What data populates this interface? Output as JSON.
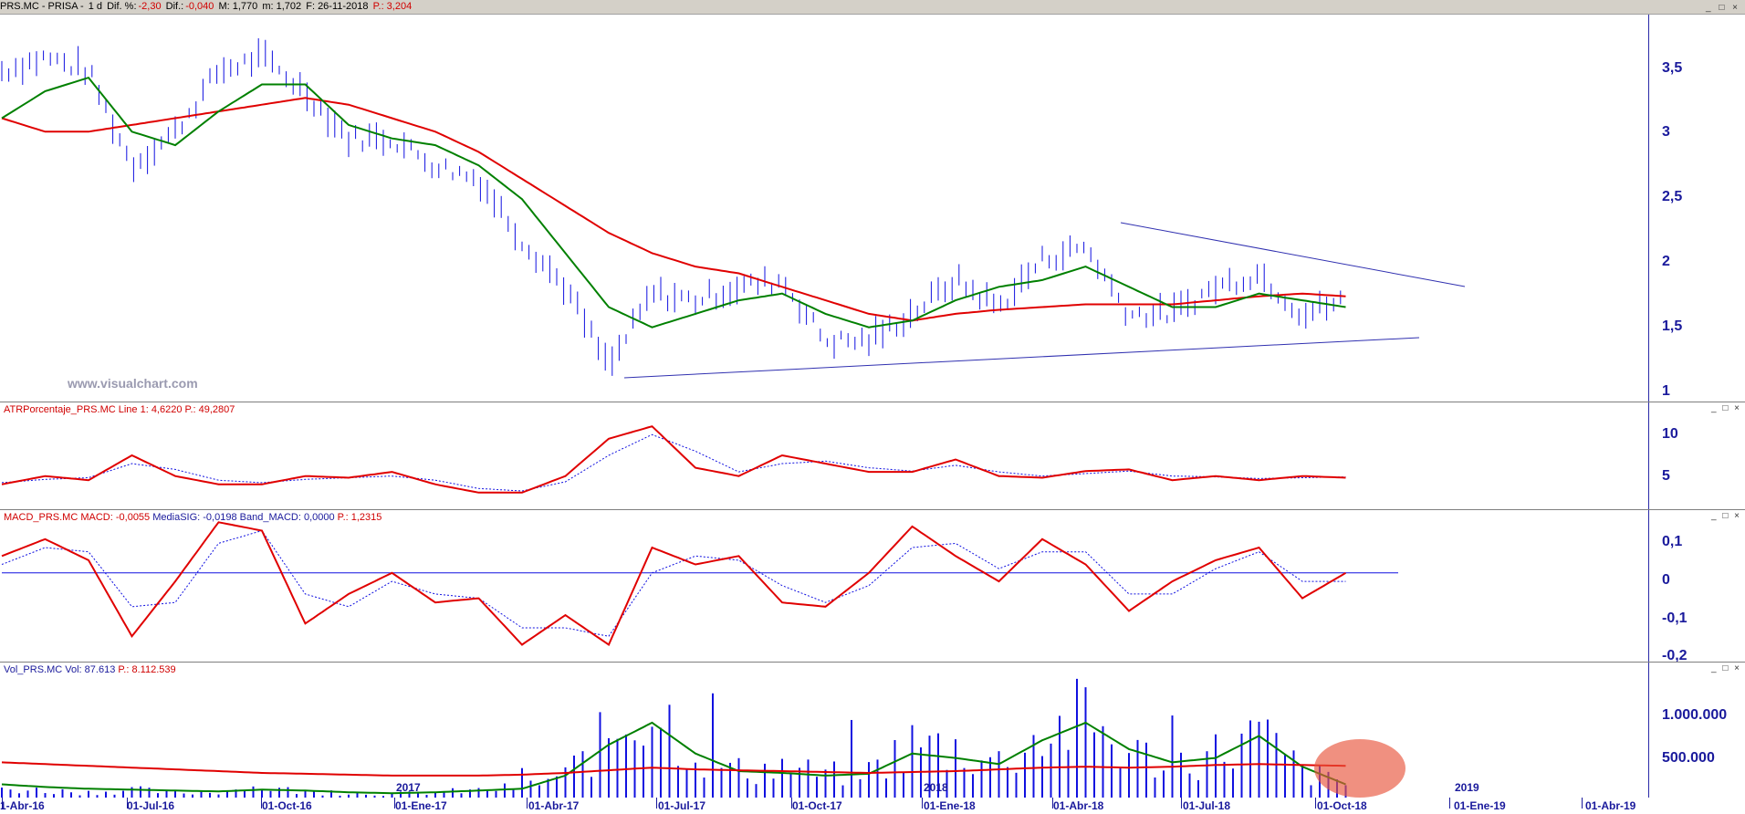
{
  "titlebar": {
    "symbol": "PRS.MC - PRISA - ",
    "period": "1 d",
    "dif_pct_label": "Dif. %:",
    "dif_pct_value": "-2,30",
    "dif_label": "Dif.:",
    "dif_value": "-0,040",
    "max_text": "M: 1,770",
    "min_text": "m: 1,702",
    "date_text": "F: 26-11-2018",
    "p_text": "P.: 3,204"
  },
  "window_buttons": {
    "minimize": "_",
    "restore": "□",
    "close": "×"
  },
  "watermark": "www.visualchart.com",
  "panels": {
    "price": {
      "ticks": [
        "3,5",
        "3",
        "2,5",
        "2",
        "1,5",
        "1"
      ]
    },
    "atr": {
      "label": "ATRPorcentaje_PRS.MC",
      "line_text": "Line 1: 4,6220",
      "p_text": "P.: 49,2807",
      "ticks": [
        "10",
        "5"
      ]
    },
    "macd": {
      "label": "MACD_PRS.MC",
      "macd_text": "MACD: -0,0055",
      "sig_text": "MediaSIG: -0,0198",
      "band_text": "Band_MACD: 0,0000",
      "p_text": "P.: 1,2315",
      "ticks": [
        "0,1",
        "0",
        "-0,1",
        "-0,2"
      ]
    },
    "vol": {
      "label": "Vol_PRS.MC",
      "vol_text": "Vol: 87.613",
      "p_text": "P.: 8.112.539",
      "ticks": [
        "1.000.000",
        "500.000"
      ]
    }
  },
  "xaxis": {
    "labels": [
      "1-Abr-16",
      "01-Jul-16",
      "01-Oct-16",
      "01-Ene-17",
      "01-Abr-17",
      "01-Jul-17",
      "01-Oct-17",
      "01-Ene-18",
      "01-Abr-18",
      "01-Jul-18",
      "01-Oct-18",
      "01-Ene-19",
      "01-Abr-19"
    ],
    "year_labels": [
      "2017",
      "2018",
      "2019"
    ]
  },
  "colors": {
    "price_bars": "#1010e0",
    "sma_short": "#008000",
    "sma_long": "#e00000",
    "trend_lines": "#3030b0",
    "highlight": "#e8553c",
    "axis_text": "#1a1a9c"
  },
  "chart_data": [
    {
      "type": "line",
      "name": "price",
      "x": [
        "2016-04",
        "2016-05",
        "2016-06",
        "2016-07",
        "2016-08",
        "2016-09",
        "2016-10",
        "2016-11",
        "2016-12",
        "2017-01",
        "2017-02",
        "2017-03",
        "2017-04",
        "2017-05",
        "2017-06",
        "2017-07",
        "2017-08",
        "2017-09",
        "2017-10",
        "2017-11",
        "2017-12",
        "2018-01",
        "2018-02",
        "2018-03",
        "2018-04",
        "2018-05",
        "2018-06",
        "2018-07",
        "2018-08",
        "2018-09",
        "2018-10",
        "2018-11"
      ],
      "series": [
        {
          "values": [
            3.45,
            3.55,
            3.45,
            2.75,
            3.0,
            3.45,
            3.55,
            3.3,
            2.95,
            2.95,
            2.75,
            2.65,
            2.2,
            1.85,
            1.25,
            1.8,
            1.75,
            1.85,
            1.9,
            1.45,
            1.45,
            1.65,
            1.9,
            1.7,
            2.05,
            2.15,
            1.65,
            1.65,
            1.85,
            1.95,
            1.65,
            1.75
          ]
        },
        {
          "values": [
            3.1,
            3.3,
            3.4,
            3.0,
            2.9,
            3.15,
            3.35,
            3.35,
            3.05,
            2.95,
            2.9,
            2.75,
            2.5,
            2.1,
            1.7,
            1.55,
            1.65,
            1.75,
            1.8,
            1.65,
            1.55,
            1.6,
            1.75,
            1.85,
            1.9,
            2.0,
            1.85,
            1.7,
            1.7,
            1.8,
            1.75,
            1.7
          ]
        },
        {
          "values": [
            3.1,
            3.0,
            3.0,
            3.05,
            3.1,
            3.15,
            3.2,
            3.25,
            3.2,
            3.1,
            3.0,
            2.85,
            2.65,
            2.45,
            2.25,
            2.1,
            2.0,
            1.95,
            1.85,
            1.75,
            1.65,
            1.6,
            1.65,
            1.68,
            1.7,
            1.72,
            1.72,
            1.72,
            1.75,
            1.78,
            1.8,
            1.78
          ]
        }
      ],
      "ylim": [
        1,
        3.8
      ]
    },
    {
      "type": "line",
      "name": "atr",
      "x": [
        "2016-04",
        "2016-05",
        "2016-06",
        "2016-07",
        "2016-08",
        "2016-09",
        "2016-10",
        "2016-11",
        "2016-12",
        "2017-01",
        "2017-02",
        "2017-03",
        "2017-04",
        "2017-05",
        "2017-06",
        "2017-07",
        "2017-08",
        "2017-09",
        "2017-10",
        "2017-11",
        "2017-12",
        "2018-01",
        "2018-02",
        "2018-03",
        "2018-04",
        "2018-05",
        "2018-06",
        "2018-07",
        "2018-08",
        "2018-09",
        "2018-10",
        "2018-11"
      ],
      "series": [
        {
          "values": [
            4,
            5,
            4.5,
            7.5,
            5,
            4,
            4,
            5,
            4.8,
            5.5,
            4,
            3,
            3,
            5,
            9.5,
            11,
            6,
            5,
            7.5,
            6.5,
            5.5,
            5.5,
            7,
            5,
            4.8,
            5.6,
            5.8,
            4.5,
            5,
            4.5,
            5,
            4.8
          ]
        },
        {
          "values": [
            4.2,
            4.6,
            4.8,
            6.5,
            5.8,
            4.5,
            4.2,
            4.6,
            4.8,
            5.0,
            4.5,
            3.5,
            3.2,
            4.3,
            7.5,
            10,
            8,
            5.5,
            6.5,
            6.8,
            6,
            5.6,
            6.3,
            5.5,
            5,
            5.3,
            5.6,
            5,
            4.9,
            4.7,
            4.8,
            4.9
          ]
        }
      ],
      "ylim": [
        1,
        13
      ]
    },
    {
      "type": "line",
      "name": "macd",
      "x": [
        "2016-04",
        "2016-05",
        "2016-06",
        "2016-07",
        "2016-08",
        "2016-09",
        "2016-10",
        "2016-11",
        "2016-12",
        "2017-01",
        "2017-02",
        "2017-03",
        "2017-04",
        "2017-05",
        "2017-06",
        "2017-07",
        "2017-08",
        "2017-09",
        "2017-10",
        "2017-11",
        "2017-12",
        "2018-01",
        "2018-02",
        "2018-03",
        "2018-04",
        "2018-05",
        "2018-06",
        "2018-07",
        "2018-08",
        "2018-09",
        "2018-10",
        "2018-11"
      ],
      "series": [
        {
          "values": [
            0.04,
            0.08,
            0.03,
            -0.15,
            -0.02,
            0.12,
            0.1,
            -0.12,
            -0.05,
            0,
            -0.07,
            -0.06,
            -0.17,
            -0.1,
            -0.17,
            0.06,
            0.02,
            0.04,
            -0.07,
            -0.08,
            0,
            0.11,
            0.04,
            -0.02,
            0.08,
            0.02,
            -0.09,
            -0.02,
            0.03,
            0.06,
            -0.06,
            0
          ]
        },
        {
          "values": [
            0.02,
            0.06,
            0.05,
            -0.08,
            -0.07,
            0.07,
            0.1,
            -0.05,
            -0.08,
            -0.02,
            -0.05,
            -0.06,
            -0.13,
            -0.13,
            -0.15,
            0.0,
            0.04,
            0.03,
            -0.03,
            -0.07,
            -0.03,
            0.06,
            0.07,
            0.01,
            0.05,
            0.05,
            -0.05,
            -0.05,
            0.01,
            0.05,
            -0.02,
            -0.02
          ]
        }
      ],
      "ylim": [
        -0.21,
        0.14
      ]
    },
    {
      "type": "bar",
      "name": "volume",
      "x": [
        "2016-04",
        "2016-05",
        "2016-06",
        "2016-07",
        "2016-08",
        "2016-09",
        "2016-10",
        "2016-11",
        "2016-12",
        "2017-01",
        "2017-02",
        "2017-03",
        "2017-04",
        "2017-05",
        "2017-06",
        "2017-07",
        "2017-08",
        "2017-09",
        "2017-10",
        "2017-11",
        "2017-12",
        "2018-01",
        "2018-02",
        "2018-03",
        "2018-04",
        "2018-05",
        "2018-06",
        "2018-07",
        "2018-08",
        "2018-09",
        "2018-10",
        "2018-11"
      ],
      "values": [
        100000,
        80000,
        60000,
        90000,
        50000,
        70000,
        120000,
        60000,
        50000,
        40000,
        60000,
        80000,
        120000,
        250000,
        700000,
        1100000,
        500000,
        300000,
        350000,
        250000,
        300000,
        600000,
        550000,
        400000,
        700000,
        900000,
        500000,
        400000,
        500000,
        700000,
        300000,
        150000
      ],
      "series": [
        {
          "values": [
            400000,
            380000,
            360000,
            340000,
            320000,
            300000,
            280000,
            270000,
            260000,
            250000,
            250000,
            250000,
            260000,
            280000,
            310000,
            340000,
            320000,
            310000,
            300000,
            290000,
            280000,
            290000,
            300000,
            320000,
            340000,
            350000,
            340000,
            350000,
            370000,
            380000,
            370000,
            360000
          ]
        },
        {
          "values": [
            150000,
            120000,
            100000,
            90000,
            80000,
            70000,
            90000,
            80000,
            60000,
            50000,
            60000,
            80000,
            100000,
            250000,
            600000,
            850000,
            500000,
            300000,
            280000,
            250000,
            270000,
            500000,
            450000,
            380000,
            650000,
            850000,
            550000,
            400000,
            450000,
            700000,
            350000,
            150000
          ]
        }
      ],
      "ylim": [
        0,
        1450000
      ]
    }
  ]
}
